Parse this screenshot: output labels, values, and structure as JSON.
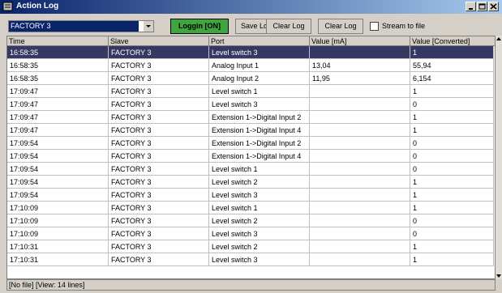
{
  "window": {
    "title": "Action Log"
  },
  "toolbar": {
    "slave_selected": "FACTORY 3",
    "loggin_label": "Loggin [ON]",
    "save_label": "Save Log",
    "clear_label": "Clear Log",
    "clear_file_label": "Clear Log File",
    "stream_label": "Stream to file"
  },
  "table": {
    "headers": [
      "Time",
      "Slave",
      "Port",
      "Value [mA]",
      "Value [Converted]"
    ],
    "rows": [
      [
        "16:58:35",
        "FACTORY 3",
        "Level switch 3",
        "",
        "1"
      ],
      [
        "16:58:35",
        "FACTORY 3",
        "Analog Input 1",
        "13,04",
        "55,94"
      ],
      [
        "16:58:35",
        "FACTORY 3",
        "Analog Input 2",
        "11,95",
        "6,154"
      ],
      [
        "17:09:47",
        "FACTORY 3",
        "Level switch 1",
        "",
        "1"
      ],
      [
        "17:09:47",
        "FACTORY 3",
        "Level switch 3",
        "",
        "0"
      ],
      [
        "17:09:47",
        "FACTORY 3",
        "Extension 1->Digital Input 2",
        "",
        "1"
      ],
      [
        "17:09:47",
        "FACTORY 3",
        "Extension 1->Digital Input 4",
        "",
        "1"
      ],
      [
        "17:09:54",
        "FACTORY 3",
        "Extension 1->Digital Input 2",
        "",
        "0"
      ],
      [
        "17:09:54",
        "FACTORY 3",
        "Extension 1->Digital Input 4",
        "",
        "0"
      ],
      [
        "17:09:54",
        "FACTORY 3",
        "Level switch 1",
        "",
        "0"
      ],
      [
        "17:09:54",
        "FACTORY 3",
        "Level switch 2",
        "",
        "1"
      ],
      [
        "17:09:54",
        "FACTORY 3",
        "Level switch 3",
        "",
        "1"
      ],
      [
        "17:10:09",
        "FACTORY 3",
        "Level switch 1",
        "",
        "1"
      ],
      [
        "17:10:09",
        "FACTORY 3",
        "Level switch 2",
        "",
        "0"
      ],
      [
        "17:10:09",
        "FACTORY 3",
        "Level switch 3",
        "",
        "0"
      ],
      [
        "17:10:31",
        "FACTORY 3",
        "Level switch 2",
        "",
        "1"
      ],
      [
        "17:10:31",
        "FACTORY 3",
        "Level switch 3",
        "",
        "1"
      ]
    ],
    "selected_row": 0
  },
  "status": {
    "text": "[No file] [View: 14 lines]"
  }
}
